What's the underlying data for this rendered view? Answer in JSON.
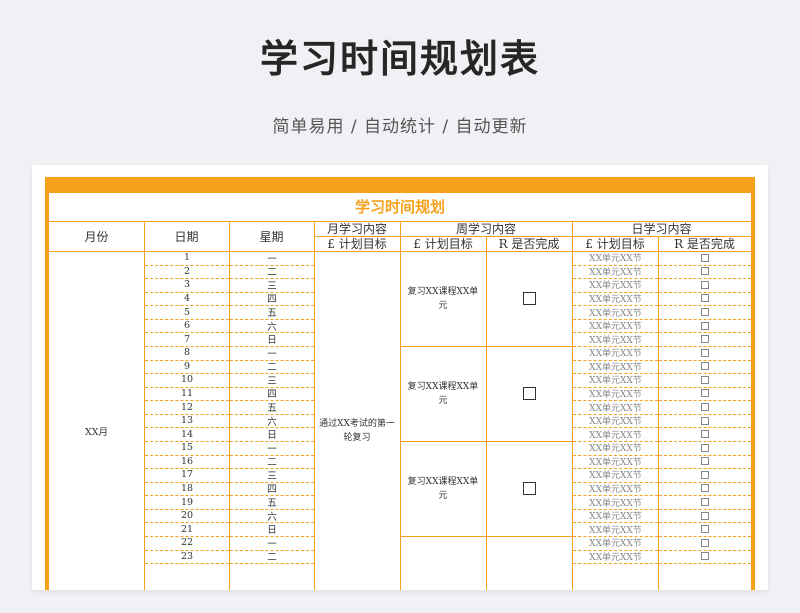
{
  "header": {
    "title": "学习时间规划表",
    "subtitle": "简单易用  /  自动统计  /  自动更新"
  },
  "sheet": {
    "title": "学习时间规划",
    "columns": {
      "month": "月份",
      "date": "日期",
      "weekday": "星期",
      "monthly": "月学习内容",
      "weekly": "周学习内容",
      "daily": "日学习内容",
      "plan_goal": "£ 计划目标",
      "done": "R 是否完成"
    },
    "month_value": "XX月",
    "monthly_goal": "通过XX考试的第一轮复习",
    "weekly_goal": "复习XX课程XX单元",
    "daily_goal": "XX单元XX节",
    "dates": [
      "1",
      "2",
      "3",
      "4",
      "5",
      "6",
      "7",
      "8",
      "9",
      "10",
      "11",
      "12",
      "13",
      "14",
      "15",
      "16",
      "17",
      "18",
      "19",
      "20",
      "21",
      "22",
      "23"
    ],
    "weekdays": [
      "一",
      "二",
      "三",
      "四",
      "五",
      "六",
      "日",
      "一",
      "二",
      "三",
      "四",
      "五",
      "六",
      "日",
      "一",
      "二",
      "三",
      "四",
      "五",
      "六",
      "日",
      "一",
      "二"
    ]
  },
  "colors": {
    "accent": "#f5a11c",
    "background": "#f0f1f4"
  }
}
